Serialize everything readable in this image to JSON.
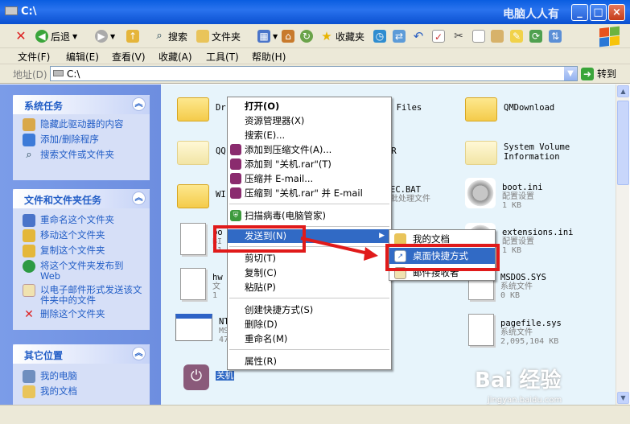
{
  "window": {
    "title": "C:\\",
    "watermark_title": "电脑人人有",
    "min": "_",
    "max": "□",
    "close": "×"
  },
  "toolbar": {
    "back": "后退",
    "search": "搜索",
    "folders": "文件夹",
    "favorites": "收藏夹"
  },
  "menubar": [
    "文件(F)",
    "编辑(E)",
    "查看(V)",
    "收藏(A)",
    "工具(T)",
    "帮助(H)"
  ],
  "address": {
    "label": "地址(D)",
    "value": "C:\\",
    "go": "转到"
  },
  "sidebar": {
    "system_tasks": {
      "title": "系统任务",
      "items": [
        "隐藏此驱动器的内容",
        "添加/删除程序",
        "搜索文件或文件夹"
      ]
    },
    "file_tasks": {
      "title": "文件和文件夹任务",
      "items": [
        "重命名这个文件夹",
        "移动这个文件夹",
        "复制这个文件夹",
        "将这个文件夹发布到 Web",
        "以电子邮件形式发送该文件夹中的文件",
        "删除这个文件夹"
      ]
    },
    "other_places": {
      "title": "其它位置",
      "items": [
        "我的电脑",
        "我的文档"
      ]
    }
  },
  "files": {
    "f1": {
      "name": "Dr"
    },
    "f2": {
      "name": "n Files"
    },
    "f3": {
      "name": "QMDownload"
    },
    "f4": {
      "name": "QQ"
    },
    "f5": {
      "name": "ER"
    },
    "f6": {
      "name": "System Volume",
      "name2": "Information"
    },
    "f7": {
      "name": "WI"
    },
    "f8": {
      "name": "EC.BAT",
      "type": "批处理文件"
    },
    "f9": {
      "name": "boot.ini",
      "type": "配置设置",
      "size": "1 KB"
    },
    "f10": {
      "name": "bo",
      "type": "BI",
      "size": "31"
    },
    "f11": {
      "name": "extensions.ini",
      "type": "配置设置",
      "size": "1 KB"
    },
    "f12": {
      "name": "hw",
      "type": "文",
      "size": "1"
    },
    "f13": {
      "name": "MSDOS.SYS",
      "type": "系统文件",
      "size": "0 KB"
    },
    "f14": {
      "name": "NT",
      "type": "MS",
      "size": "47"
    },
    "f15": {
      "name": "pagefile.sys",
      "type": "系统文件",
      "size": "2,095,104 KB"
    },
    "f16": {
      "name": "关机"
    }
  },
  "context_menu": [
    "打开(O)",
    "资源管理器(X)",
    "搜索(E)...",
    "添加到压缩文件(A)...",
    "添加到 \"关机.rar\"(T)",
    "压缩并 E-mail...",
    "压缩到 \"关机.rar\" 并 E-mail",
    "扫描病毒(电脑管家)",
    "发送到(N)",
    "剪切(T)",
    "复制(C)",
    "粘贴(P)",
    "创建快捷方式(S)",
    "删除(D)",
    "重命名(M)",
    "属性(R)"
  ],
  "sendto_menu": [
    "我的文档",
    "桌面快捷方式",
    "邮件接收者"
  ],
  "watermark": {
    "brand": "Bai 经验",
    "url": "jingyan.baidu.com"
  },
  "colors": {
    "highlight": "#316ac5",
    "annotation_red": "#e01a1a",
    "xp_blue": "#0a5de0"
  }
}
